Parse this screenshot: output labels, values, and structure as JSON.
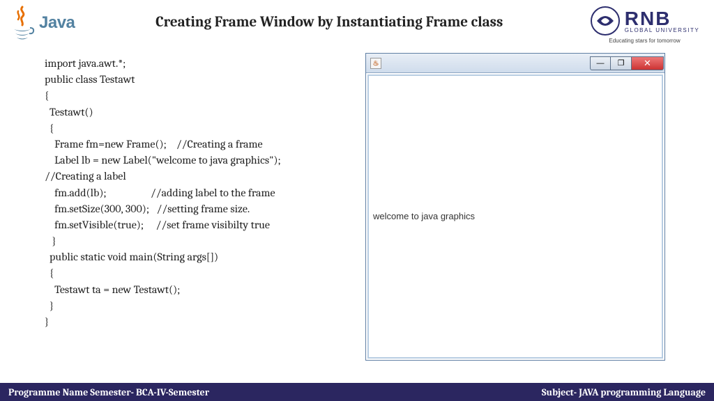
{
  "header": {
    "java_text": "Java",
    "title": "Creating Frame Window by Instantiating Frame class",
    "uni_name": "RNB",
    "uni_sub": "GLOBAL UNIVERSITY",
    "uni_tag": "Educating stars for tomorrow"
  },
  "code": {
    "l1": "import java.awt.*;",
    "l2": "public class Testawt",
    "l3": "{",
    "l4": "  Testawt()",
    "l5": "  {",
    "l6": "    Frame fm=new Frame();    //Creating a frame",
    "l7": "    Label lb = new Label(\"welcome to java graphics\");",
    "l8": "//Creating a label",
    "l9": "    fm.add(lb);                  //adding label to the frame",
    "l10": "    fm.setSize(300, 300);   //setting frame size.",
    "l11": "    fm.setVisible(true);     //set frame visibilty true",
    "l12": "   }",
    "l13": "  public static void main(String args[])",
    "l14": "  {",
    "l15": "    Testawt ta = new Testawt();",
    "l16": "  }",
    "l17": "}"
  },
  "window": {
    "icon_glyph": "♨",
    "label_text": "welcome to java graphics",
    "min_glyph": "—",
    "max_glyph": "❐",
    "close_glyph": "✕"
  },
  "footer": {
    "left": "Programme Name Semester- BCA-IV-Semester",
    "right": "Subject- JAVA programming Language"
  }
}
